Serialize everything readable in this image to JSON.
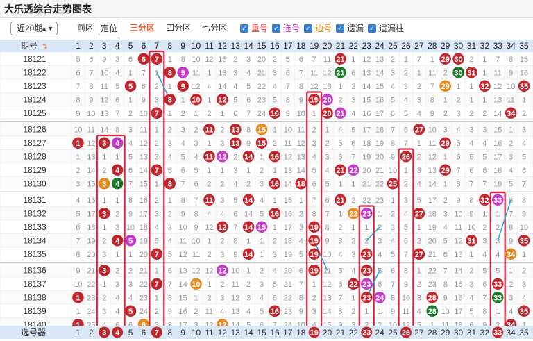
{
  "title": "大乐透综合走势图表",
  "toolbar": {
    "period_select": "近20期",
    "front_area": "前区",
    "locate": "定位",
    "split3": "三分区",
    "split4": "四分区",
    "split7": "七分区",
    "checkboxes": [
      {
        "label": "重号",
        "color": "#d33",
        "checked": true
      },
      {
        "label": "连号",
        "color": "#c3c",
        "checked": true
      },
      {
        "label": "边号",
        "color": "#e80",
        "checked": true
      },
      {
        "label": "遗漏",
        "color": "#333",
        "checked": true
      },
      {
        "label": "遗漏柱",
        "color": "#333",
        "checked": true
      }
    ]
  },
  "header_label": "期号",
  "footer_label": "选号器",
  "columns": [
    "1",
    "2",
    "3",
    "4",
    "5",
    "6",
    "7",
    "8",
    "9",
    "10",
    "11",
    "12",
    "13",
    "14",
    "15",
    "16",
    "17",
    "18",
    "19",
    "20",
    "21",
    "22",
    "23",
    "24",
    "25",
    "26",
    "27",
    "28",
    "29",
    "30",
    "31",
    "32",
    "33",
    "34",
    "35"
  ],
  "colors": {
    "ball_red": "#c0272d",
    "ball_pink": "#c23bc4",
    "ball_orange": "#e68a1f",
    "ball_green": "#1b7a2a",
    "frame": "#e0203a",
    "arrow": "#2aa3d8",
    "header_bg": "#d9e6f5",
    "shade_bg": "#e6edf6"
  },
  "rows": [
    {
      "period": "18121",
      "cells": [
        "5",
        "6",
        "9",
        "3",
        "6",
        "6",
        "7",
        "1",
        "8",
        "10",
        "12",
        "15",
        "2",
        "3",
        "20",
        "2",
        "5",
        "6",
        "7",
        "11",
        "21",
        "1",
        "12",
        "13",
        "2",
        "1",
        "7",
        "1",
        "29",
        "30",
        "2",
        "1",
        "7",
        "8",
        "15"
      ]
    },
    {
      "period": "18122",
      "cells": [
        "6",
        "7",
        "10",
        "4",
        "1",
        "7",
        "1",
        "8",
        "9",
        "11",
        "1",
        "13",
        "3",
        "4",
        "21",
        "3",
        "6",
        "7",
        "11",
        "12",
        "21",
        "6",
        "13",
        "14",
        "3",
        "2",
        "1",
        "11",
        "2",
        "30",
        "31",
        "1",
        "11",
        "9",
        "16"
      ]
    },
    {
      "period": "18123",
      "cells": [
        "7",
        "8",
        "11",
        "5",
        "5",
        "6",
        "2",
        "1",
        "9",
        "12",
        "4",
        "14",
        "4",
        "5",
        "22",
        "4",
        "7",
        "8",
        "12",
        "13",
        "1",
        "2",
        "14",
        "15",
        "4",
        "3",
        "2",
        "7",
        "29",
        "1",
        "1",
        "32",
        "12",
        "10",
        "35"
      ]
    },
    {
      "period": "18124",
      "cells": [
        "8",
        "9",
        "12",
        "6",
        "1",
        "9",
        "3",
        "8",
        "1",
        "10",
        "1",
        "12",
        "5",
        "6",
        "23",
        "5",
        "8",
        "9",
        "19",
        "20",
        "2",
        "3",
        "15",
        "16",
        "5",
        "4",
        "3",
        "8",
        "1",
        "2",
        "1",
        "1",
        "13",
        "11",
        "1"
      ]
    },
    {
      "period": "18125",
      "cells": [
        "9",
        "10",
        "13",
        "7",
        "2",
        "10",
        "7",
        "1",
        "2",
        "1",
        "2",
        "1",
        "6",
        "7",
        "24",
        "16",
        "9",
        "10",
        "1",
        "21",
        "3",
        "4",
        "16",
        "17",
        "6",
        "5",
        "4",
        "9",
        "2",
        "3",
        "2",
        "2",
        "14",
        "34",
        "2"
      ]
    },
    {
      "period": "18126",
      "cells": [
        "10",
        "11",
        "14",
        "8",
        "3",
        "11",
        "1",
        "2",
        "3",
        "2",
        "11",
        "2",
        "13",
        "8",
        "15",
        "1",
        "10",
        "11",
        "2",
        "1",
        "4",
        "5",
        "17",
        "18",
        "7",
        "6",
        "27",
        "10",
        "3",
        "4",
        "3",
        "3",
        "15",
        "1",
        "3"
      ]
    },
    {
      "period": "18127",
      "cells": [
        "1",
        "12",
        "3",
        "4",
        "4",
        "12",
        "2",
        "3",
        "4",
        "3",
        "1",
        "3",
        "1",
        "9",
        "1",
        "2",
        "11",
        "12",
        "3",
        "2",
        "5",
        "6",
        "18",
        "19",
        "8",
        "7",
        "1",
        "11",
        "29",
        "5",
        "4",
        "4",
        "16",
        "2",
        "4"
      ]
    },
    {
      "period": "18128",
      "cells": [
        "1",
        "13",
        "1",
        "1",
        "5",
        "13",
        "3",
        "4",
        "5",
        "4",
        "11",
        "12",
        "2",
        "14",
        "1",
        "16",
        "12",
        "13",
        "4",
        "3",
        "6",
        "7",
        "19",
        "20",
        "9",
        "26",
        "2",
        "12",
        "1",
        "6",
        "5",
        "5",
        "17",
        "3",
        "5"
      ]
    },
    {
      "period": "18129",
      "cells": [
        "2",
        "14",
        "2",
        "4",
        "6",
        "14",
        "7",
        "5",
        "6",
        "5",
        "1",
        "1",
        "3",
        "1",
        "2",
        "1",
        "13",
        "14",
        "5",
        "4",
        "21",
        "22",
        "20",
        "21",
        "10",
        "1",
        "3",
        "13",
        "29",
        "7",
        "6",
        "6",
        "18",
        "4",
        "6"
      ]
    },
    {
      "period": "18130",
      "cells": [
        "3",
        "15",
        "3",
        "4",
        "7",
        "15",
        "1",
        "8",
        "7",
        "6",
        "2",
        "2",
        "4",
        "2",
        "3",
        "16",
        "14",
        "18",
        "6",
        "5",
        "1",
        "1",
        "21",
        "22",
        "25",
        "2",
        "4",
        "14",
        "1",
        "8",
        "7",
        "7",
        "19",
        "5",
        "7"
      ]
    },
    {
      "period": "18131",
      "cells": [
        "4",
        "16",
        "1",
        "1",
        "8",
        "16",
        "2",
        "1",
        "8",
        "7",
        "1",
        "3",
        "5",
        "1",
        "4",
        "1",
        "15",
        "1",
        "7",
        "6",
        "21",
        "2",
        "22",
        "23",
        "1",
        "3",
        "5",
        "17",
        "2",
        "9",
        "8",
        "32",
        "33",
        "6",
        "8"
      ]
    },
    {
      "period": "18132",
      "cells": [
        "5",
        "17",
        "3",
        "2",
        "9",
        "17",
        "3",
        "2",
        "9",
        "8",
        "4",
        "4",
        "6",
        "14",
        "5",
        "16",
        "16",
        "2",
        "8",
        "7",
        "1",
        "22",
        "23",
        "1",
        "2",
        "4",
        "27",
        "18",
        "3",
        "10",
        "9",
        "1",
        "1",
        "7",
        "9"
      ]
    },
    {
      "period": "18133",
      "cells": [
        "6",
        "18",
        "1",
        "3",
        "10",
        "18",
        "4",
        "3",
        "10",
        "9",
        "12",
        "12",
        "7",
        "14",
        "15",
        "1",
        "17",
        "3",
        "19",
        "8",
        "2",
        "1",
        "1",
        "2",
        "3",
        "5",
        "1",
        "19",
        "4",
        "11",
        "10",
        "2",
        "2",
        "8",
        "10"
      ]
    },
    {
      "period": "18134",
      "cells": [
        "7",
        "19",
        "2",
        "4",
        "5",
        "19",
        "5",
        "4",
        "11",
        "10",
        "1",
        "2",
        "8",
        "1",
        "1",
        "2",
        "18",
        "4",
        "19",
        "9",
        "3",
        "2",
        "2",
        "3",
        "4",
        "6",
        "2",
        "20",
        "5",
        "12",
        "31",
        "3",
        "3",
        "9",
        "35"
      ]
    },
    {
      "period": "18135",
      "cells": [
        "8",
        "20",
        "3",
        "1",
        "1",
        "20",
        "7",
        "5",
        "12",
        "11",
        "2",
        "3",
        "9",
        "14",
        "1",
        "3",
        "19",
        "5",
        "19",
        "10",
        "4",
        "3",
        "23",
        "4",
        "5",
        "7",
        "27",
        "21",
        "6",
        "13",
        "1",
        "4",
        "4",
        "34",
        "1"
      ]
    },
    {
      "period": "18136",
      "cells": [
        "9",
        "21",
        "3",
        "2",
        "2",
        "21",
        "1",
        "6",
        "13",
        "12",
        "12",
        "1",
        "10",
        "1",
        "2",
        "4",
        "20",
        "6",
        "19",
        "11",
        "5",
        "4",
        "1",
        "5",
        "6",
        "8",
        "1",
        "22",
        "7",
        "14",
        "2",
        "5",
        "5",
        "1",
        "2"
      ]
    },
    {
      "period": "18137",
      "cells": [
        "10",
        "22",
        "1",
        "3",
        "3",
        "22",
        "7",
        "7",
        "14",
        "10",
        "1",
        "2",
        "11",
        "2",
        "3",
        "5",
        "21",
        "7",
        "1",
        "12",
        "6",
        "22",
        "23",
        "6",
        "7",
        "9",
        "2",
        "23",
        "8",
        "15",
        "3",
        "6",
        "33",
        "2",
        "3"
      ]
    },
    {
      "period": "18138",
      "cells": [
        "1",
        "23",
        "2",
        "4",
        "4",
        "23",
        "1",
        "8",
        "15",
        "1",
        "2",
        "3",
        "12",
        "3",
        "4",
        "6",
        "22",
        "8",
        "2",
        "13",
        "7",
        "1",
        "23",
        "24",
        "8",
        "10",
        "3",
        "28",
        "9",
        "16",
        "4",
        "7",
        "33",
        "3",
        "4"
      ]
    },
    {
      "period": "18139",
      "cells": [
        "1",
        "24",
        "3",
        "4",
        "5",
        "24",
        "2",
        "9",
        "16",
        "2",
        "11",
        "4",
        "13",
        "4",
        "5",
        "16",
        "23",
        "9",
        "3",
        "14",
        "8",
        "2",
        "1",
        "1",
        "9",
        "11",
        "4",
        "28",
        "10",
        "17",
        "5",
        "8",
        "1",
        "4",
        "35"
      ]
    },
    {
      "period": "18140",
      "cells": [
        "1",
        "25",
        "4",
        "6",
        "6",
        "25",
        "3",
        "8",
        "17",
        "3",
        "12",
        "5",
        "14",
        "5",
        "6",
        "7",
        "24",
        "10",
        "4",
        "15",
        "9",
        "3",
        "2",
        "2",
        "10",
        "12",
        "5",
        "1",
        "11",
        "18",
        "6",
        "9",
        "2",
        "35",
        "1"
      ]
    }
  ],
  "balls": [
    {
      "row": 0,
      "col": 5,
      "type": "red"
    },
    {
      "row": 0,
      "col": 6,
      "type": "red"
    },
    {
      "row": 0,
      "col": 20,
      "type": "red"
    },
    {
      "row": 0,
      "col": 28,
      "type": "red"
    },
    {
      "row": 0,
      "col": 29,
      "type": "red"
    },
    {
      "row": 1,
      "col": 7,
      "type": "red"
    },
    {
      "row": 1,
      "col": 8,
      "type": "pink"
    },
    {
      "row": 1,
      "col": 20,
      "type": "green"
    },
    {
      "row": 1,
      "col": 29,
      "type": "green"
    },
    {
      "row": 1,
      "col": 30,
      "type": "red"
    },
    {
      "row": 2,
      "col": 4,
      "type": "red"
    },
    {
      "row": 2,
      "col": 8,
      "type": "red"
    },
    {
      "row": 2,
      "col": 28,
      "type": "orange"
    },
    {
      "row": 2,
      "col": 31,
      "type": "red"
    },
    {
      "row": 2,
      "col": 34,
      "type": "red"
    },
    {
      "row": 3,
      "col": 7,
      "type": "red"
    },
    {
      "row": 3,
      "col": 9,
      "type": "red"
    },
    {
      "row": 3,
      "col": 11,
      "type": "red"
    },
    {
      "row": 3,
      "col": 18,
      "type": "red"
    },
    {
      "row": 3,
      "col": 19,
      "type": "pink"
    },
    {
      "row": 4,
      "col": 6,
      "type": "red"
    },
    {
      "row": 4,
      "col": 15,
      "type": "red"
    },
    {
      "row": 4,
      "col": 19,
      "type": "red"
    },
    {
      "row": 4,
      "col": 20,
      "type": "pink"
    },
    {
      "row": 4,
      "col": 33,
      "type": "red"
    },
    {
      "row": 5,
      "col": 10,
      "type": "red"
    },
    {
      "row": 5,
      "col": 12,
      "type": "red"
    },
    {
      "row": 5,
      "col": 14,
      "type": "orange"
    },
    {
      "row": 5,
      "col": 26,
      "type": "red"
    },
    {
      "row": 6,
      "col": 0,
      "type": "red"
    },
    {
      "row": 6,
      "col": 2,
      "type": "red"
    },
    {
      "row": 6,
      "col": 3,
      "type": "pink"
    },
    {
      "row": 6,
      "col": 12,
      "type": "red"
    },
    {
      "row": 6,
      "col": 14,
      "type": "red"
    },
    {
      "row": 6,
      "col": 28,
      "type": "red"
    },
    {
      "row": 7,
      "col": 10,
      "type": "red"
    },
    {
      "row": 7,
      "col": 11,
      "type": "pink"
    },
    {
      "row": 7,
      "col": 13,
      "type": "red"
    },
    {
      "row": 7,
      "col": 15,
      "type": "red"
    },
    {
      "row": 7,
      "col": 25,
      "type": "red"
    },
    {
      "row": 8,
      "col": 3,
      "type": "red"
    },
    {
      "row": 8,
      "col": 6,
      "type": "red"
    },
    {
      "row": 8,
      "col": 20,
      "type": "red"
    },
    {
      "row": 8,
      "col": 21,
      "type": "pink"
    },
    {
      "row": 8,
      "col": 28,
      "type": "red"
    },
    {
      "row": 9,
      "col": 2,
      "type": "orange"
    },
    {
      "row": 9,
      "col": 3,
      "type": "green"
    },
    {
      "row": 9,
      "col": 7,
      "type": "red"
    },
    {
      "row": 9,
      "col": 15,
      "type": "red"
    },
    {
      "row": 9,
      "col": 17,
      "type": "red"
    },
    {
      "row": 9,
      "col": 24,
      "type": "red"
    },
    {
      "row": 10,
      "col": 10,
      "type": "red"
    },
    {
      "row": 10,
      "col": 13,
      "type": "red"
    },
    {
      "row": 10,
      "col": 20,
      "type": "red"
    },
    {
      "row": 10,
      "col": 31,
      "type": "red"
    },
    {
      "row": 10,
      "col": 32,
      "type": "pink"
    },
    {
      "row": 11,
      "col": 2,
      "type": "red"
    },
    {
      "row": 11,
      "col": 15,
      "type": "red"
    },
    {
      "row": 11,
      "col": 21,
      "type": "orange"
    },
    {
      "row": 11,
      "col": 22,
      "type": "pink"
    },
    {
      "row": 11,
      "col": 26,
      "type": "red"
    },
    {
      "row": 12,
      "col": 11,
      "type": "red"
    },
    {
      "row": 12,
      "col": 13,
      "type": "red"
    },
    {
      "row": 12,
      "col": 14,
      "type": "pink"
    },
    {
      "row": 12,
      "col": 18,
      "type": "red"
    },
    {
      "row": 13,
      "col": 3,
      "type": "red"
    },
    {
      "row": 13,
      "col": 4,
      "type": "pink"
    },
    {
      "row": 13,
      "col": 18,
      "type": "red"
    },
    {
      "row": 13,
      "col": 30,
      "type": "red"
    },
    {
      "row": 13,
      "col": 34,
      "type": "red"
    },
    {
      "row": 14,
      "col": 6,
      "type": "red"
    },
    {
      "row": 14,
      "col": 13,
      "type": "red"
    },
    {
      "row": 14,
      "col": 18,
      "type": "red"
    },
    {
      "row": 14,
      "col": 22,
      "type": "red"
    },
    {
      "row": 14,
      "col": 26,
      "type": "red"
    },
    {
      "row": 14,
      "col": 33,
      "type": "orange"
    },
    {
      "row": 15,
      "col": 2,
      "type": "red"
    },
    {
      "row": 15,
      "col": 11,
      "type": "pink"
    },
    {
      "row": 15,
      "col": 18,
      "type": "red"
    },
    {
      "row": 15,
      "col": 22,
      "type": "red"
    },
    {
      "row": 16,
      "col": 6,
      "type": "red"
    },
    {
      "row": 16,
      "col": 9,
      "type": "orange"
    },
    {
      "row": 16,
      "col": 21,
      "type": "red"
    },
    {
      "row": 16,
      "col": 22,
      "type": "pink"
    },
    {
      "row": 16,
      "col": 32,
      "type": "red"
    },
    {
      "row": 17,
      "col": 0,
      "type": "red"
    },
    {
      "row": 17,
      "col": 22,
      "type": "red"
    },
    {
      "row": 17,
      "col": 23,
      "type": "pink"
    },
    {
      "row": 17,
      "col": 27,
      "type": "red"
    },
    {
      "row": 17,
      "col": 32,
      "type": "green"
    },
    {
      "row": 18,
      "col": 4,
      "type": "red"
    },
    {
      "row": 18,
      "col": 15,
      "type": "red"
    },
    {
      "row": 18,
      "col": 27,
      "type": "green"
    },
    {
      "row": 18,
      "col": 34,
      "type": "red"
    },
    {
      "row": 19,
      "col": 0,
      "type": "red"
    },
    {
      "row": 19,
      "col": 5,
      "type": "orange"
    },
    {
      "row": 19,
      "col": 11,
      "type": "orange"
    },
    {
      "row": 19,
      "col": 33,
      "type": "red"
    }
  ],
  "selector_balls": [
    {
      "col": 2,
      "type": "red"
    },
    {
      "col": 3,
      "type": "red"
    },
    {
      "col": 6,
      "type": "red"
    },
    {
      "col": 18,
      "type": "red"
    },
    {
      "col": 22,
      "type": "red"
    },
    {
      "col": 25,
      "type": "red"
    },
    {
      "col": 32,
      "type": "red"
    }
  ],
  "frames": [
    {
      "col0": 2,
      "col1": 3,
      "row0": 6,
      "row1": 20
    },
    {
      "col0": 6,
      "col1": 6,
      "row0": 0,
      "row1": 20
    },
    {
      "col0": 18,
      "col1": 18,
      "row0": 3,
      "row1": 20
    },
    {
      "col0": 22,
      "col1": 22,
      "row0": 11,
      "row1": 20
    },
    {
      "col0": 25,
      "col1": 25,
      "row0": 7,
      "row1": 20
    },
    {
      "col0": 32,
      "col1": 32,
      "row0": 10,
      "row1": 20
    }
  ]
}
